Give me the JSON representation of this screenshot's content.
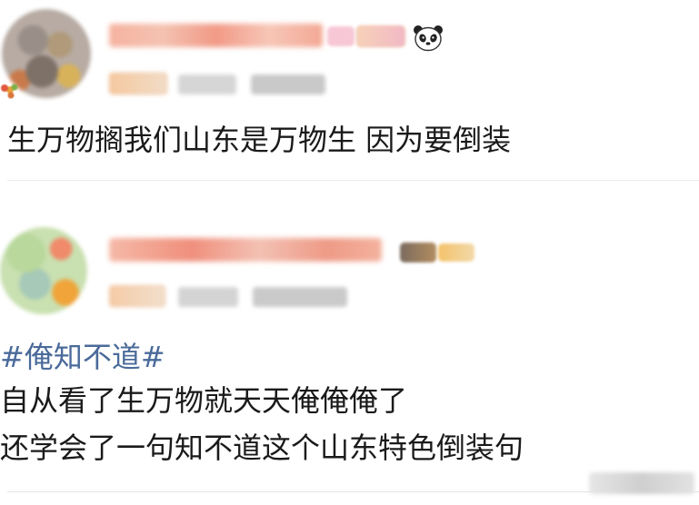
{
  "posts": [
    {
      "text": "生万物搁我们山东是万物生 因为要倒装"
    },
    {
      "hashtag": "#俺知不道#",
      "lines": [
        "自从看了生万物就天天俺俺俺了",
        "还学会了一句知不道这个山东特色倒装句"
      ]
    }
  ],
  "icons": {
    "post1_name_badge": "panda-icon",
    "post1_avatar_decoration": "flower-icon"
  },
  "colors": {
    "text": "#1a1a1a",
    "hashtag": "#4a6a9a",
    "background": "#ffffff",
    "divider": "#ececec"
  }
}
